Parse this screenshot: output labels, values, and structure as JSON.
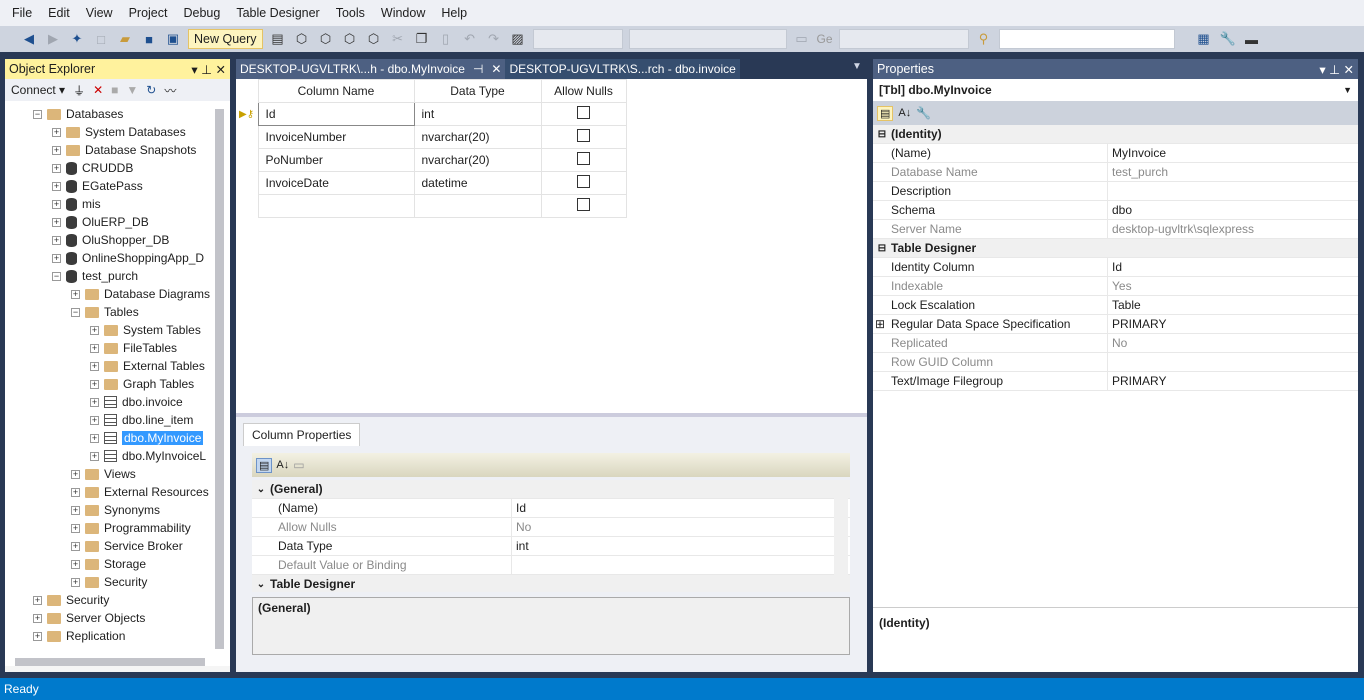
{
  "menu": [
    "File",
    "Edit",
    "View",
    "Project",
    "Debug",
    "Table Designer",
    "Tools",
    "Window",
    "Help"
  ],
  "toolbar": {
    "new_query": "New Query",
    "geo_label": "Ge"
  },
  "object_explorer": {
    "title": "Object Explorer",
    "connect": "Connect",
    "items": [
      {
        "label": "Databases",
        "level": 1,
        "icon": "folder",
        "exp": "-"
      },
      {
        "label": "System Databases",
        "level": 2,
        "icon": "folder",
        "exp": "+"
      },
      {
        "label": "Database Snapshots",
        "level": 2,
        "icon": "folder",
        "exp": "+"
      },
      {
        "label": "CRUDDB",
        "level": 2,
        "icon": "db",
        "exp": "+"
      },
      {
        "label": "EGatePass",
        "level": 2,
        "icon": "db",
        "exp": "+"
      },
      {
        "label": "mis",
        "level": 2,
        "icon": "db",
        "exp": "+"
      },
      {
        "label": "OluERP_DB",
        "level": 2,
        "icon": "db",
        "exp": "+"
      },
      {
        "label": "OluShopper_DB",
        "level": 2,
        "icon": "db",
        "exp": "+"
      },
      {
        "label": "OnlineShoppingApp_D",
        "level": 2,
        "icon": "db",
        "exp": "+"
      },
      {
        "label": "test_purch",
        "level": 2,
        "icon": "db",
        "exp": "-"
      },
      {
        "label": "Database Diagrams",
        "level": 3,
        "icon": "folder",
        "exp": "+"
      },
      {
        "label": "Tables",
        "level": 3,
        "icon": "folder",
        "exp": "-"
      },
      {
        "label": "System Tables",
        "level": 4,
        "icon": "folder",
        "exp": "+"
      },
      {
        "label": "FileTables",
        "level": 4,
        "icon": "folder",
        "exp": "+"
      },
      {
        "label": "External Tables",
        "level": 4,
        "icon": "folder",
        "exp": "+"
      },
      {
        "label": "Graph Tables",
        "level": 4,
        "icon": "folder",
        "exp": "+"
      },
      {
        "label": "dbo.invoice",
        "level": 4,
        "icon": "table",
        "exp": "+"
      },
      {
        "label": "dbo.line_item",
        "level": 4,
        "icon": "table",
        "exp": "+"
      },
      {
        "label": "dbo.MyInvoice",
        "level": 4,
        "icon": "table",
        "exp": "+",
        "selected": true
      },
      {
        "label": "dbo.MyInvoiceL",
        "level": 4,
        "icon": "table",
        "exp": "+"
      },
      {
        "label": "Views",
        "level": 3,
        "icon": "folder",
        "exp": "+"
      },
      {
        "label": "External Resources",
        "level": 3,
        "icon": "folder",
        "exp": "+"
      },
      {
        "label": "Synonyms",
        "level": 3,
        "icon": "folder",
        "exp": "+"
      },
      {
        "label": "Programmability",
        "level": 3,
        "icon": "folder",
        "exp": "+"
      },
      {
        "label": "Service Broker",
        "level": 3,
        "icon": "folder",
        "exp": "+"
      },
      {
        "label": "Storage",
        "level": 3,
        "icon": "folder",
        "exp": "+"
      },
      {
        "label": "Security",
        "level": 3,
        "icon": "folder",
        "exp": "+"
      },
      {
        "label": "Security",
        "level": 1,
        "icon": "folder",
        "exp": "+"
      },
      {
        "label": "Server Objects",
        "level": 1,
        "icon": "folder",
        "exp": "+"
      },
      {
        "label": "Replication",
        "level": 1,
        "icon": "folder",
        "exp": "+"
      }
    ]
  },
  "tabs": [
    {
      "label": "DESKTOP-UGVLTRK\\...h - dbo.MyInvoice",
      "active": true
    },
    {
      "label": "DESKTOP-UGVLTRK\\S...rch - dbo.invoice",
      "active": false
    }
  ],
  "designer": {
    "headers": [
      "Column Name",
      "Data Type",
      "Allow Nulls"
    ],
    "rows": [
      {
        "name": "Id",
        "type": "int",
        "nulls": false,
        "pk": true
      },
      {
        "name": "InvoiceNumber",
        "type": "nvarchar(20)",
        "nulls": false
      },
      {
        "name": "PoNumber",
        "type": "nvarchar(20)",
        "nulls": false
      },
      {
        "name": "InvoiceDate",
        "type": "datetime",
        "nulls": false
      },
      {
        "name": "",
        "type": "",
        "nulls": false
      }
    ]
  },
  "column_properties": {
    "tab": "Column Properties",
    "rows": [
      {
        "k": "(General)",
        "cat": true
      },
      {
        "k": "(Name)",
        "v": "Id"
      },
      {
        "k": "Allow Nulls",
        "v": "No",
        "gray": true
      },
      {
        "k": "Data Type",
        "v": "int"
      },
      {
        "k": "Default Value or Binding",
        "v": "",
        "gray": true
      },
      {
        "k": "Table Designer",
        "cat": true
      }
    ],
    "description": "(General)"
  },
  "properties": {
    "title": "Properties",
    "object": "[Tbl] dbo.MyInvoice",
    "rows": [
      {
        "k": "(Identity)",
        "cat": true
      },
      {
        "k": "(Name)",
        "v": "MyInvoice"
      },
      {
        "k": "Database Name",
        "v": "test_purch",
        "gray": true
      },
      {
        "k": "Description",
        "v": ""
      },
      {
        "k": "Schema",
        "v": "dbo"
      },
      {
        "k": "Server Name",
        "v": "desktop-ugvltrk\\sqlexpress",
        "gray": true
      },
      {
        "k": "Table Designer",
        "cat": true
      },
      {
        "k": "Identity Column",
        "v": "Id"
      },
      {
        "k": "Indexable",
        "v": "Yes",
        "gray": true
      },
      {
        "k": "Lock Escalation",
        "v": "Table"
      },
      {
        "k": "Regular Data Space Specification",
        "v": "PRIMARY",
        "exp": true
      },
      {
        "k": "Replicated",
        "v": "No",
        "gray": true
      },
      {
        "k": "Row GUID Column",
        "v": "",
        "gray": true
      },
      {
        "k": "Text/Image Filegroup",
        "v": "PRIMARY"
      }
    ],
    "description": "(Identity)"
  },
  "status": "Ready",
  "colors": {
    "frame": "#293955",
    "status": "#007acc",
    "selection": "#3399ff",
    "active_title": "#fff29d"
  }
}
